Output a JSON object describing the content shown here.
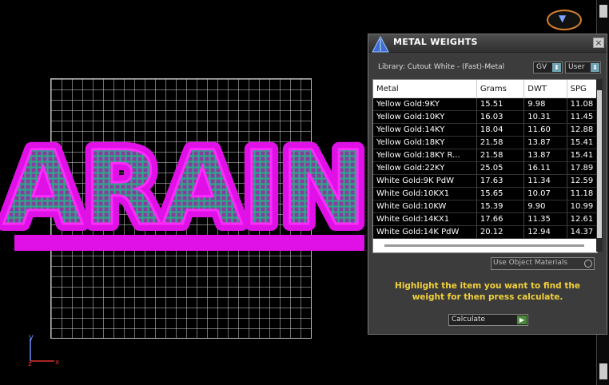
{
  "panel": {
    "title": "METAL WEIGHTS",
    "close_label": "×",
    "library_label": "Library: Cutout White - (Fast)-Metal",
    "gv_select": "GV",
    "user_select": "User",
    "columns": [
      "Metal",
      "Grams",
      "DWT",
      "SPG"
    ],
    "rows": [
      [
        "Yellow Gold:9KY",
        "15.51",
        "9.98",
        "11.08"
      ],
      [
        "Yellow Gold:10KY",
        "16.03",
        "10.31",
        "11.45"
      ],
      [
        "Yellow Gold:14KY",
        "18.04",
        "11.60",
        "12.88"
      ],
      [
        "Yellow Gold:18KY",
        "21.58",
        "13.87",
        "15.41"
      ],
      [
        "Yellow Gold:18KY R...",
        "21.58",
        "13.87",
        "15.41"
      ],
      [
        "Yellow Gold:22KY",
        "25.05",
        "16.11",
        "17.89"
      ],
      [
        "White Gold:9K PdW",
        "17.63",
        "11.34",
        "12.59"
      ],
      [
        "White Gold:10KX1",
        "15.65",
        "10.07",
        "11.18"
      ],
      [
        "White Gold:10KW",
        "15.39",
        "9.90",
        "10.99"
      ],
      [
        "White Gold:14KX1",
        "17.66",
        "11.35",
        "12.61"
      ],
      [
        "White Gold:14K PdW",
        "20.12",
        "12.94",
        "14.37"
      ]
    ],
    "use_object_materials": "Use Object Materials",
    "instruction": "Highlight the item you want to find the weight for then press calculate.",
    "calculate_label": "Calculate",
    "calculate_arrow": "▶",
    "select_arrow": "⬍"
  },
  "viewport": {
    "model_text": "ARAIN",
    "axis_y": "y",
    "axis_z": "z",
    "axis_x": "x",
    "model_color": "#e011e6",
    "mesh_color": "#2fa58a"
  }
}
